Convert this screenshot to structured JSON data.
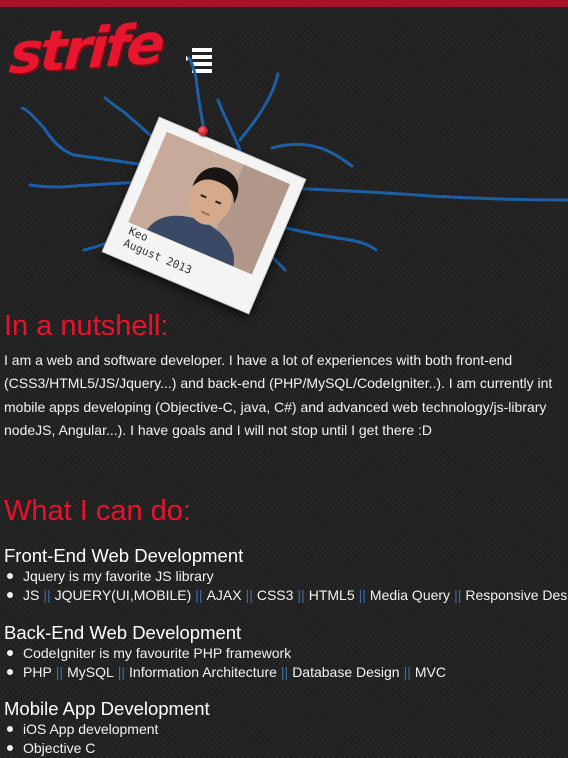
{
  "brand": {
    "logo_text": "strife"
  },
  "profile": {
    "caption_line1": "Keo",
    "caption_line2": "August 2013"
  },
  "about": {
    "heading": "In a nutshell:",
    "lines": [
      "I am a web and software developer. I have a lot of experiences with both front-end",
      "(CSS3/HTML5/JS/Jquery...) and back-end (PHP/MySQL/CodeIgniter..). I am currently int",
      "mobile apps developing (Objective-C, java, C#) and advanced web technology/js-library",
      "nodeJS, Angular...). I have goals and I will not stop until I get there :D"
    ]
  },
  "skills": {
    "heading": "What I can do:",
    "frontend": {
      "title": "Front-End Web Development",
      "note": "Jquery is my favorite JS library",
      "tags": [
        "JS",
        "JQUERY(UI,MOBILE)",
        "AJAX",
        "CSS3",
        "HTML5",
        "Media Query",
        "Responsive Des"
      ]
    },
    "backend": {
      "title": "Back-End Web Development",
      "note": "CodeIgniter is my favourite PHP framework",
      "tags": [
        "PHP",
        "MySQL",
        "Information Architecture",
        "Database Design",
        "MVC"
      ]
    },
    "mobile": {
      "title": "Mobile App Development",
      "items": [
        "iOS App development",
        "Objective C"
      ]
    }
  },
  "colors": {
    "accent": "#e8132b",
    "top_bar": "#a3132a",
    "scribble": "#1d5fa6",
    "separator": "#3a6fa8"
  }
}
